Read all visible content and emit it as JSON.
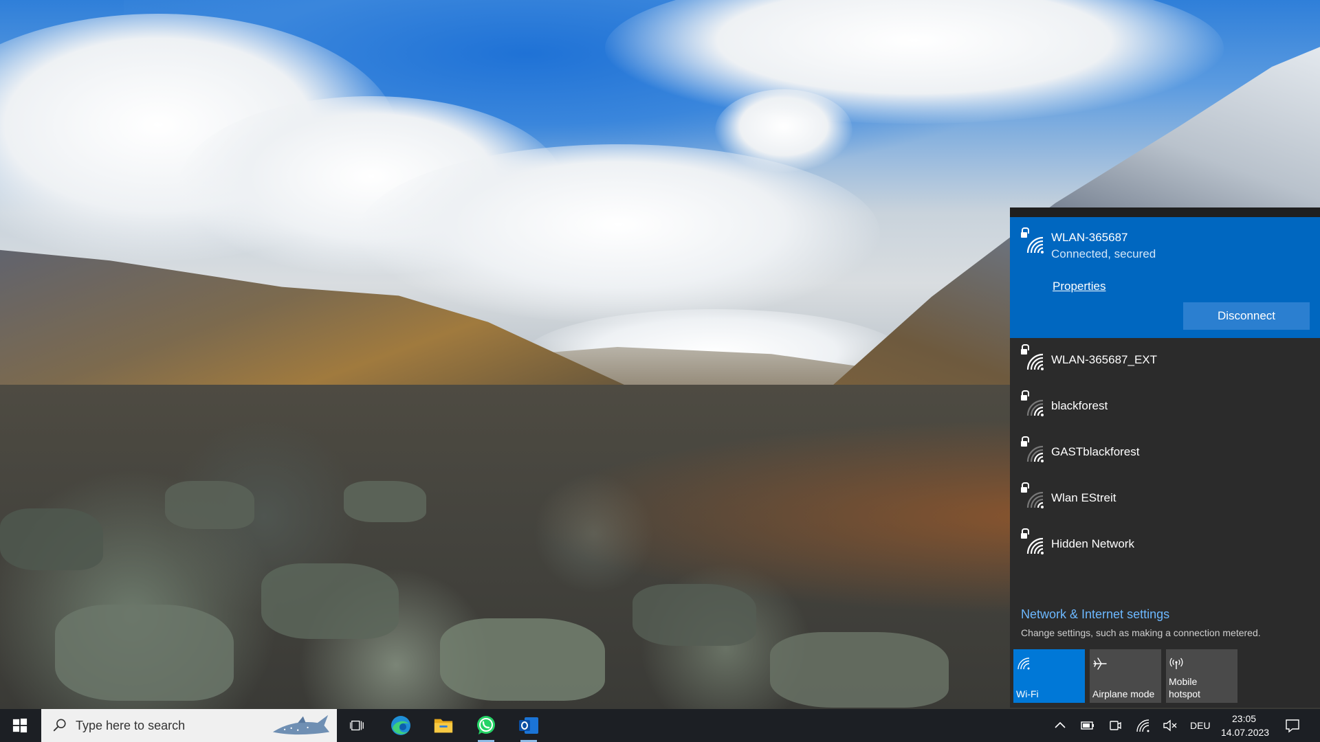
{
  "flyout": {
    "connected_network": {
      "name": "WLAN-365687",
      "status": "Connected, secured",
      "properties_label": "Properties",
      "disconnect_label": "Disconnect"
    },
    "networks": [
      {
        "name": "WLAN-365687_EXT",
        "signal": 4
      },
      {
        "name": "blackforest",
        "signal": 2
      },
      {
        "name": "GASTblackforest",
        "signal": 2
      },
      {
        "name": "Wlan EStreit",
        "signal": 1
      },
      {
        "name": "Hidden Network",
        "signal": 4
      }
    ],
    "settings": {
      "title": "Network & Internet settings",
      "subtitle": "Change settings, such as making a connection metered."
    },
    "quick_actions": [
      {
        "label": "Wi-Fi",
        "icon": "wifi-icon",
        "active": true
      },
      {
        "label": "Airplane mode",
        "icon": "airplane-icon",
        "active": false
      },
      {
        "label": "Mobile\nhotspot",
        "icon": "hotspot-icon",
        "active": false
      }
    ]
  },
  "taskbar": {
    "search_placeholder": "Type here to search",
    "apps": [
      "task-view-icon",
      "edge-icon",
      "file-explorer-icon",
      "whatsapp-icon",
      "outlook-icon"
    ],
    "tray": {
      "language": "DEU",
      "time": "23:05",
      "date": "14.07.2023"
    }
  },
  "colors": {
    "accent": "#0067c0",
    "flyout_bg": "#2b2b2b",
    "taskbar_bg": "#1c1f24",
    "link": "#6cb8ff"
  }
}
